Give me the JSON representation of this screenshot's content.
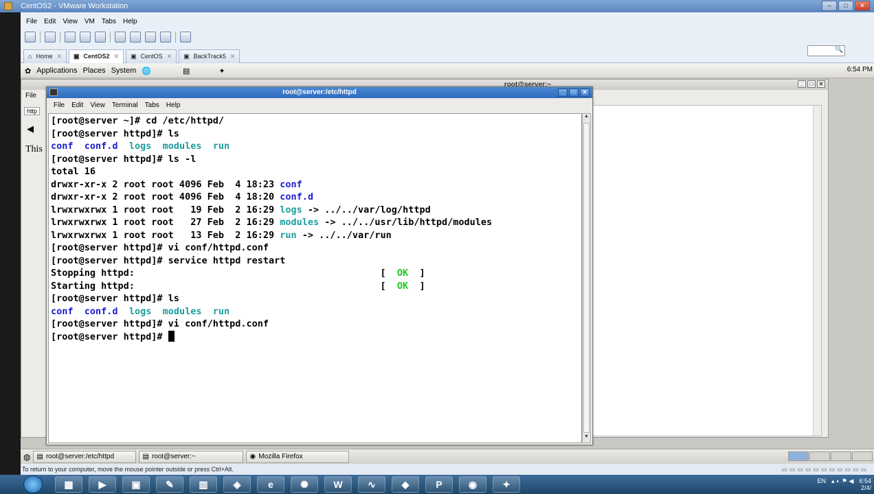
{
  "vmware": {
    "title": "CentOS2 - VMware Workstation",
    "menu": [
      "File",
      "Edit",
      "View",
      "VM",
      "Tabs",
      "Help"
    ],
    "tabs": [
      {
        "label": "Home",
        "active": false
      },
      {
        "label": "CentOS2",
        "active": true
      },
      {
        "label": "CentOS",
        "active": false
      },
      {
        "label": "BackTrack5",
        "active": false
      }
    ],
    "status_hint": "To return to your computer, move the mouse pointer outside or press Ctrl+Alt."
  },
  "gnome_panel": {
    "menus": [
      "Applications",
      "Places",
      "System"
    ],
    "clock": "6:54 PM"
  },
  "firefox": {
    "title": "root@server:~",
    "menu_partial": "File",
    "tab_partial": "http",
    "body_partial": "This"
  },
  "terminal": {
    "title": "root@server:/etc/httpd",
    "menu": [
      "File",
      "Edit",
      "View",
      "Terminal",
      "Tabs",
      "Help"
    ],
    "lines": [
      {
        "segments": [
          {
            "t": "[root@server ~]# cd /etc/httpd/",
            "c": ""
          }
        ]
      },
      {
        "segments": [
          {
            "t": "[root@server httpd]# ls",
            "c": ""
          }
        ]
      },
      {
        "segments": [
          {
            "t": "conf",
            "c": "c-blue"
          },
          {
            "t": "  ",
            "c": ""
          },
          {
            "t": "conf.d",
            "c": "c-blue"
          },
          {
            "t": "  ",
            "c": ""
          },
          {
            "t": "logs",
            "c": "c-cyan"
          },
          {
            "t": "  ",
            "c": ""
          },
          {
            "t": "modules",
            "c": "c-cyan"
          },
          {
            "t": "  ",
            "c": ""
          },
          {
            "t": "run",
            "c": "c-cyan"
          }
        ]
      },
      {
        "segments": [
          {
            "t": "[root@server httpd]# ls -l",
            "c": ""
          }
        ]
      },
      {
        "segments": [
          {
            "t": "total 16",
            "c": ""
          }
        ]
      },
      {
        "segments": [
          {
            "t": "drwxr-xr-x 2 root root 4096 Feb  4 18:23 ",
            "c": ""
          },
          {
            "t": "conf",
            "c": "c-blue"
          }
        ]
      },
      {
        "segments": [
          {
            "t": "drwxr-xr-x 2 root root 4096 Feb  4 18:20 ",
            "c": ""
          },
          {
            "t": "conf.d",
            "c": "c-blue"
          }
        ]
      },
      {
        "segments": [
          {
            "t": "lrwxrwxrwx 1 root root   19 Feb  2 16:29 ",
            "c": ""
          },
          {
            "t": "logs",
            "c": "c-cyan"
          },
          {
            "t": " -> ../../var/log/httpd",
            "c": ""
          }
        ]
      },
      {
        "segments": [
          {
            "t": "lrwxrwxrwx 1 root root   27 Feb  2 16:29 ",
            "c": ""
          },
          {
            "t": "modules",
            "c": "c-cyan"
          },
          {
            "t": " -> ../../usr/lib/httpd/modules",
            "c": ""
          }
        ]
      },
      {
        "segments": [
          {
            "t": "lrwxrwxrwx 1 root root   13 Feb  2 16:29 ",
            "c": ""
          },
          {
            "t": "run",
            "c": "c-cyan"
          },
          {
            "t": " -> ../../var/run",
            "c": ""
          }
        ]
      },
      {
        "segments": [
          {
            "t": "[root@server httpd]# vi conf/httpd.conf",
            "c": ""
          }
        ]
      },
      {
        "segments": [
          {
            "t": "[root@server httpd]# service httpd restart",
            "c": ""
          }
        ]
      },
      {
        "segments": [
          {
            "t": "Stopping httpd:                                            [  ",
            "c": ""
          },
          {
            "t": "OK",
            "c": "c-green"
          },
          {
            "t": "  ]",
            "c": ""
          }
        ]
      },
      {
        "segments": [
          {
            "t": "Starting httpd:                                            [  ",
            "c": ""
          },
          {
            "t": "OK",
            "c": "c-green"
          },
          {
            "t": "  ]",
            "c": ""
          }
        ]
      },
      {
        "segments": [
          {
            "t": "[root@server httpd]# ls",
            "c": ""
          }
        ]
      },
      {
        "segments": [
          {
            "t": "conf",
            "c": "c-blue"
          },
          {
            "t": "  ",
            "c": ""
          },
          {
            "t": "conf.d",
            "c": "c-blue"
          },
          {
            "t": "  ",
            "c": ""
          },
          {
            "t": "logs",
            "c": "c-cyan"
          },
          {
            "t": "  ",
            "c": ""
          },
          {
            "t": "modules",
            "c": "c-cyan"
          },
          {
            "t": "  ",
            "c": ""
          },
          {
            "t": "run",
            "c": "c-cyan"
          }
        ]
      },
      {
        "segments": [
          {
            "t": "[root@server httpd]# vi conf/httpd.conf",
            "c": ""
          }
        ]
      },
      {
        "segments": [
          {
            "t": "[root@server httpd]# ",
            "c": ""
          }
        ],
        "cursor": true
      }
    ]
  },
  "gnome_taskbar": [
    {
      "label": "root@server:/etc/httpd",
      "icon": "terminal-icon"
    },
    {
      "label": "root@server:~",
      "icon": "terminal-icon"
    },
    {
      "label": "Mozilla Firefox",
      "icon": "firefox-icon"
    }
  ],
  "windows_tray": {
    "lang": "EN",
    "time": "6:54",
    "date": "2/4/"
  },
  "windows_taskbar_icons": [
    "explorer-icon",
    "media-player-icon",
    "vmware-icon",
    "paint-icon",
    "calculator-icon",
    "shield-icon",
    "ie-icon",
    "network-icon",
    "word-icon",
    "chart-icon",
    "app-icon",
    "powerpoint-icon",
    "firefox-icon",
    "tool-icon"
  ]
}
